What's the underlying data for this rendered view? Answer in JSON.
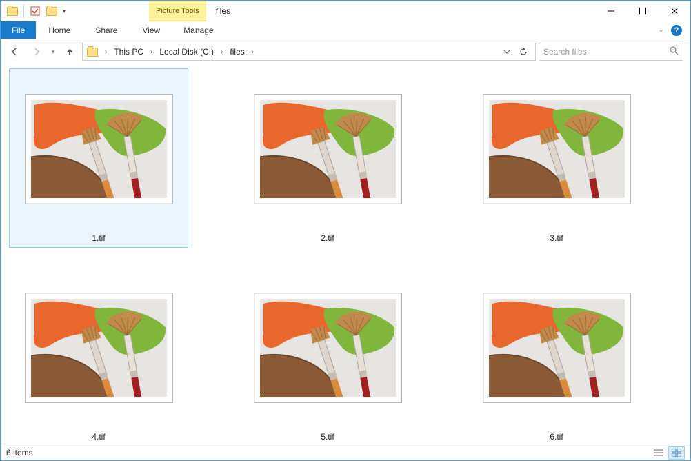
{
  "window": {
    "title": "files",
    "picture_tools_label": "Picture Tools"
  },
  "ribbon": {
    "file": "File",
    "tabs": [
      "Home",
      "Share",
      "View"
    ],
    "manage": "Manage"
  },
  "address": {
    "segments": [
      "This PC",
      "Local Disk (C:)",
      "files"
    ]
  },
  "search": {
    "placeholder": "Search files"
  },
  "files": [
    {
      "name": "1.tif",
      "selected": true
    },
    {
      "name": "2.tif",
      "selected": false
    },
    {
      "name": "3.tif",
      "selected": false
    },
    {
      "name": "4.tif",
      "selected": false
    },
    {
      "name": "5.tif",
      "selected": false
    },
    {
      "name": "6.tif",
      "selected": false
    }
  ],
  "status": {
    "count_label": "6 items"
  }
}
